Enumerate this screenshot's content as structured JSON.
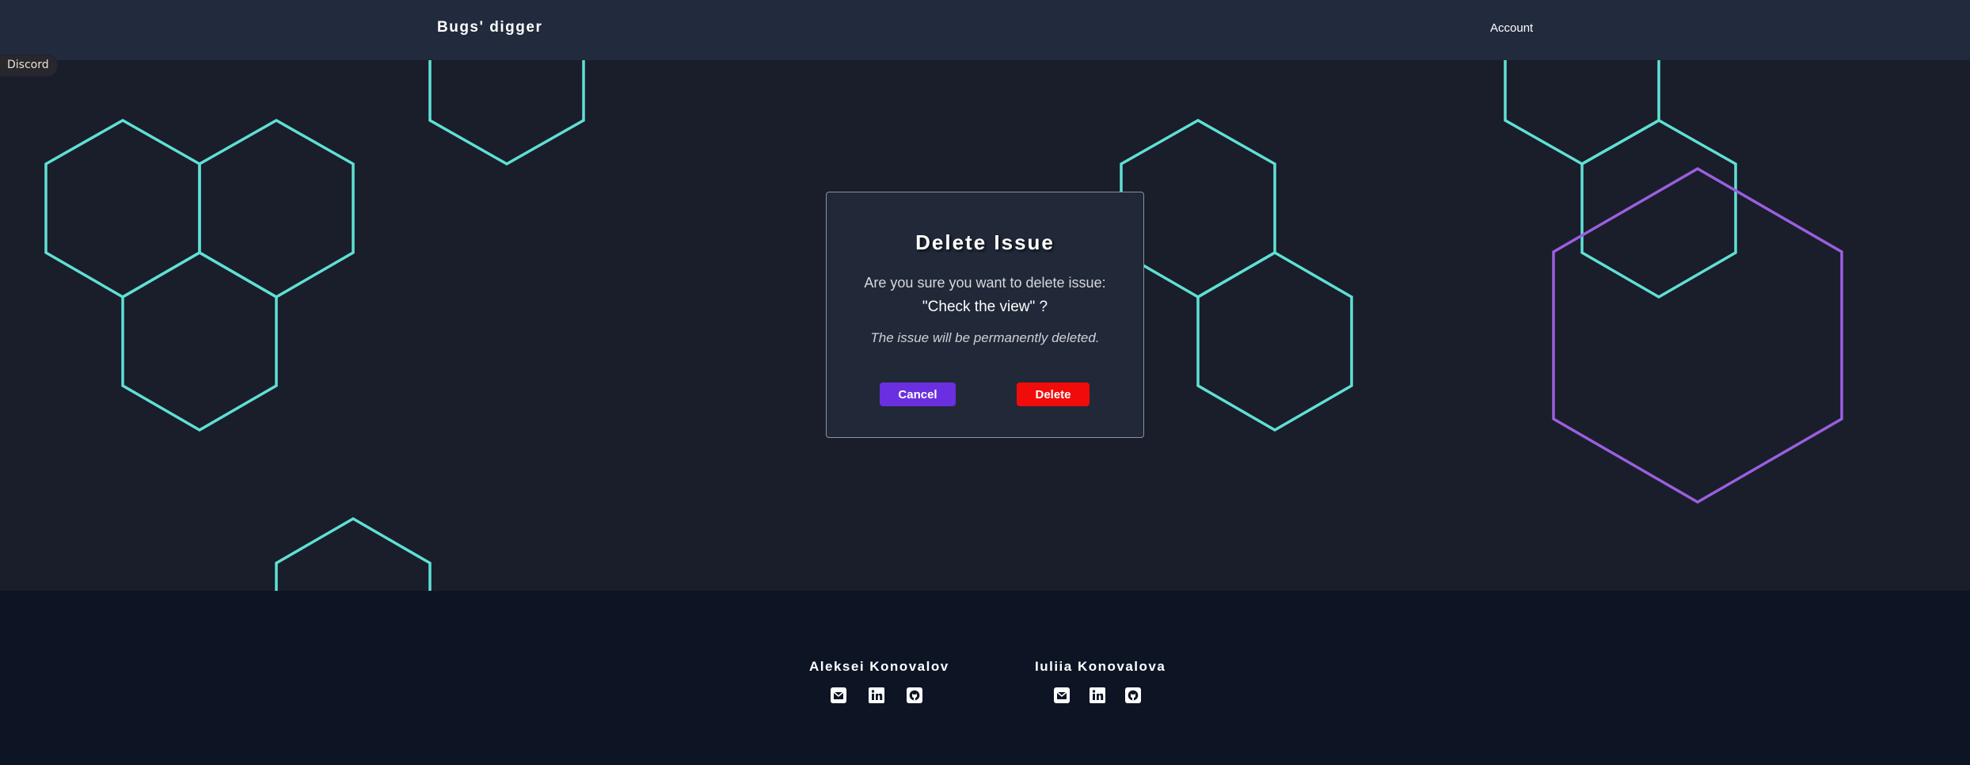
{
  "header": {
    "brand": "Bugs' digger",
    "account_label": "Account"
  },
  "discord_tab": {
    "label": "Discord"
  },
  "modal": {
    "title": "Delete Issue",
    "question": "Are you sure you want to delete issue:",
    "issue_name": "\"Check the view\" ?",
    "warning": "The issue will be permanently deleted.",
    "cancel_label": "Cancel",
    "delete_label": "Delete"
  },
  "footer": {
    "authors": [
      {
        "name": "Aleksei Konovalov",
        "icons": [
          "email-icon",
          "linkedin-icon",
          "github-icon"
        ]
      },
      {
        "name": "Iuliia Konovalova",
        "icons": [
          "email-icon",
          "linkedin-icon",
          "github-icon"
        ]
      }
    ]
  },
  "colors": {
    "header_bg": "#222a3d",
    "page_bg": "#1a1e2a",
    "footer_bg": "#0d1525",
    "hex_teal": "#5fe0d5",
    "hex_purple": "#9a5fe0",
    "cancel_button": "#6a2fe0",
    "delete_button": "#f20b0b"
  }
}
